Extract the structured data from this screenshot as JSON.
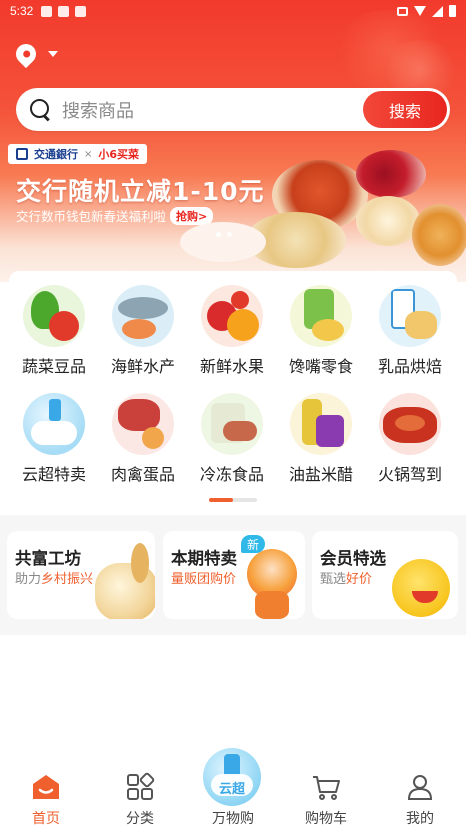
{
  "status_bar": {
    "time": "5:32"
  },
  "search": {
    "placeholder": "搜索商品",
    "button": "搜索"
  },
  "banner": {
    "bank": "交通銀行",
    "partner": "小6买菜",
    "title": "交行随机立减1-10元",
    "subtitle": "交行数币钱包新春送福利啦",
    "cta": "抢购>"
  },
  "categories": [
    {
      "label": "蔬菜豆品",
      "icon": "vegetables-icon"
    },
    {
      "label": "海鲜水产",
      "icon": "seafood-icon"
    },
    {
      "label": "新鲜水果",
      "icon": "fruit-icon"
    },
    {
      "label": "馋嘴零食",
      "icon": "snacks-icon"
    },
    {
      "label": "乳品烘焙",
      "icon": "dairy-bakery-icon"
    },
    {
      "label": "云超特卖",
      "icon": "cloud-sale-icon"
    },
    {
      "label": "肉禽蛋品",
      "icon": "meat-eggs-icon"
    },
    {
      "label": "冷冻食品",
      "icon": "frozen-food-icon"
    },
    {
      "label": "油盐米醋",
      "icon": "oil-rice-icon"
    },
    {
      "label": "火锅驾到",
      "icon": "hotpot-icon"
    }
  ],
  "promos": [
    {
      "title": "共富工坊",
      "sub_plain": "助力",
      "sub_hl": "乡村振兴"
    },
    {
      "title": "本期特卖",
      "sub_plain": "",
      "sub_hl": "量贩团购价",
      "tag": "新"
    },
    {
      "title": "会员特选",
      "sub_plain": "甄选",
      "sub_hl": "好价"
    }
  ],
  "tabs": [
    {
      "label": "首页",
      "active": true
    },
    {
      "label": "分类"
    },
    {
      "label": "万物购",
      "badge": "云超"
    },
    {
      "label": "购物车"
    },
    {
      "label": "我的"
    }
  ],
  "colors": {
    "brand_red": "#f23a2c",
    "accent_orange": "#f0602f",
    "new_tag_blue": "#2fb8e8"
  }
}
